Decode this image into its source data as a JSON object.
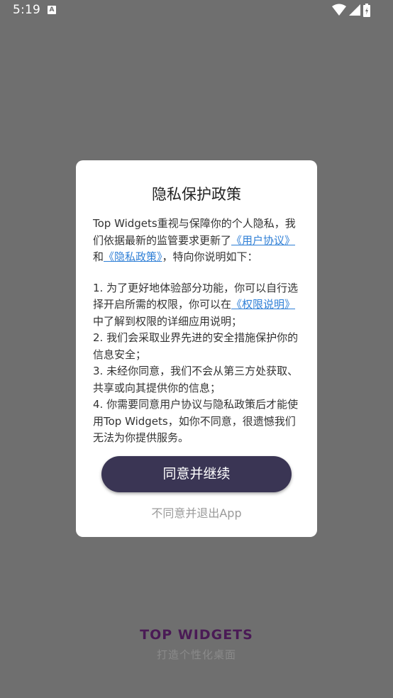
{
  "status_bar": {
    "time": "5:19",
    "notification_icon": "A"
  },
  "dialog": {
    "title": "隐私保护政策",
    "intro_prefix": "Top Widgets重视与保障你的个人隐私，我们依据最新的监管要求更新了",
    "user_agreement_link": "《用户协议》",
    "and_text": "和",
    "privacy_policy_link": "《隐私政策》",
    "intro_suffix": "，特向你说明如下：",
    "item1_prefix": "1. 为了更好地体验部分功能，你可以自行选择开启所需的权限，你可以在",
    "permission_link": "《权限说明》",
    "item1_suffix": "中了解到权限的详细应用说明；",
    "item2": "2. 我们会采取业界先进的安全措施保护你的信息安全；",
    "item3": "3. 未经你同意，我们不会从第三方处获取、共享或向其提供你的信息；",
    "item4": "4. 你需要同意用户协议与隐私政策后才能使用Top Widgets，如你不同意，很遗憾我们无法为你提供服务。",
    "agree_button": "同意并继续",
    "decline_link": "不同意并退出App"
  },
  "brand": {
    "logo": "TOP WIDGETS",
    "tagline": "打造个性化桌面"
  },
  "colors": {
    "overlay": "#6f6f6f",
    "button": "#3a3554",
    "link": "#2f7fd6"
  }
}
